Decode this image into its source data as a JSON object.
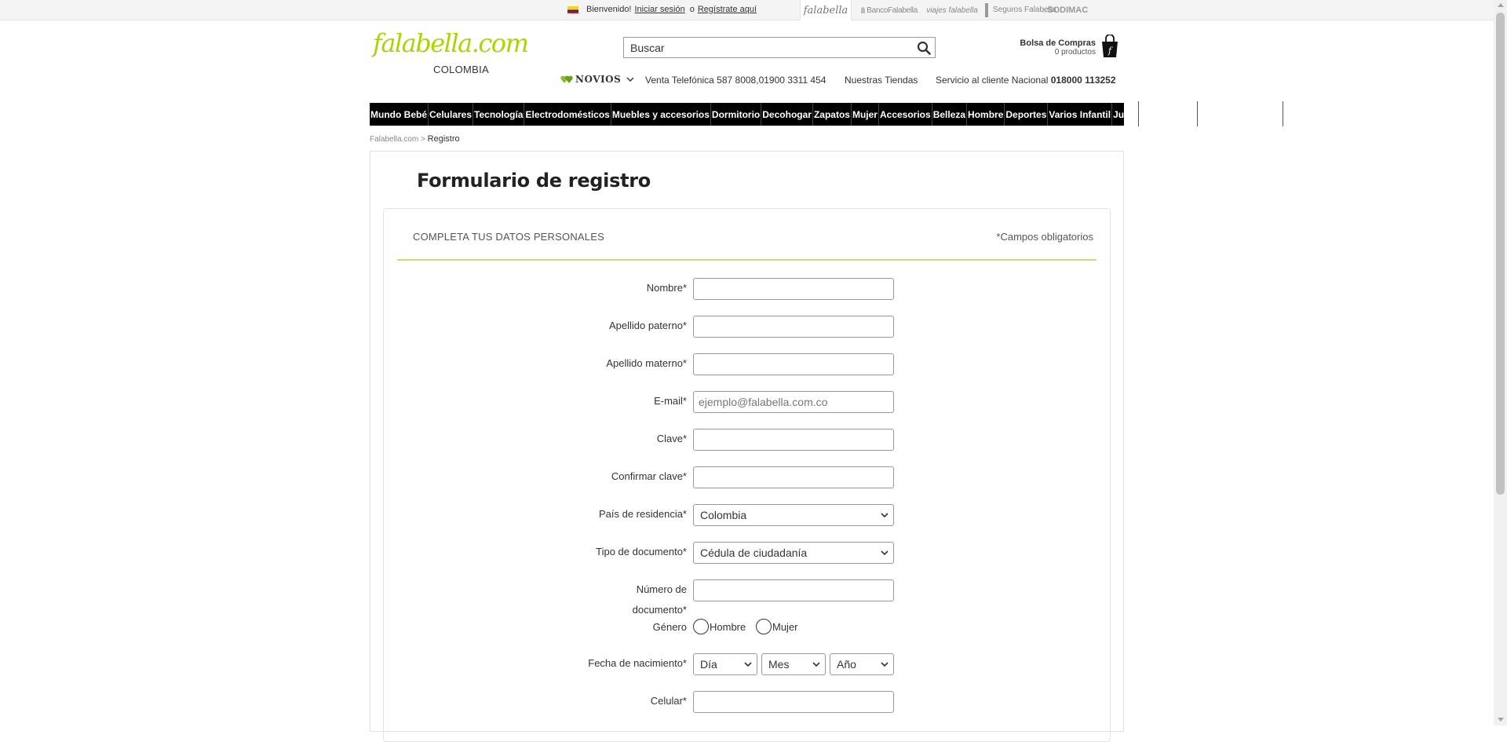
{
  "topbar": {
    "welcome": "Bienvenido!",
    "login_link": "Iniciar sesión",
    "or": "o",
    "register_link": "Regístrate aquí",
    "brands": [
      {
        "name": "falabella"
      },
      {
        "name": "BancoFalabella"
      },
      {
        "name": "viajes falabella"
      },
      {
        "name": "Seguros Falabella"
      },
      {
        "name": "SODIMAC"
      }
    ]
  },
  "header": {
    "logo": "falabella.com",
    "country": "COLOMBIA",
    "search_placeholder": "Buscar",
    "cart_title": "Bolsa de Compras",
    "cart_count": "0  productos",
    "novios": "NOVIOS",
    "venta": "Venta Telefónica 587 8008,01900 3311 454",
    "tiendas": "Nuestras Tiendas",
    "servicio": "Servicio al cliente Nacional",
    "servicio_num": "018000 113252"
  },
  "categories": [
    "Mundo Bebé",
    "Celulares",
    "Tecnología",
    "Electrodomésticos",
    "Muebles y accesorios",
    "Dormitorio",
    "Decohogar",
    "Zapatos",
    "Mujer",
    "Accesorios",
    "Belleza",
    "Hombre",
    "Deportes",
    "Varios Infantil",
    "Juguetería"
  ],
  "breadcrumb": {
    "home": "Falabella.com",
    "sep": ">",
    "current": "Registro"
  },
  "form": {
    "title": "Formulario de registro",
    "section": "COMPLETA TUS DATOS PERSONALES",
    "required_note": "*Campos obligatorios",
    "labels": {
      "nombre": "Nombre*",
      "apellido_paterno": "Apellido paterno*",
      "apellido_materno": "Apellido materno*",
      "email": "E-mail*",
      "clave": "Clave*",
      "confirmar_clave": "Confirmar clave*",
      "pais": "País de residencia*",
      "tipo_doc": "Tipo de documento*",
      "numero_doc_1": "Número de",
      "numero_doc_2": "documento*",
      "genero": "Género",
      "fecha": "Fecha de nacimiento*",
      "celular": "Celular*"
    },
    "email_placeholder": "ejemplo@falabella.com.co",
    "pais_value": "Colombia",
    "tipo_doc_value": "Cédula de ciudadanía",
    "genero_options": [
      "Hombre",
      "Mujer"
    ],
    "fecha_dia": "Día",
    "fecha_mes": "Mes",
    "fecha_anio": "Año"
  }
}
